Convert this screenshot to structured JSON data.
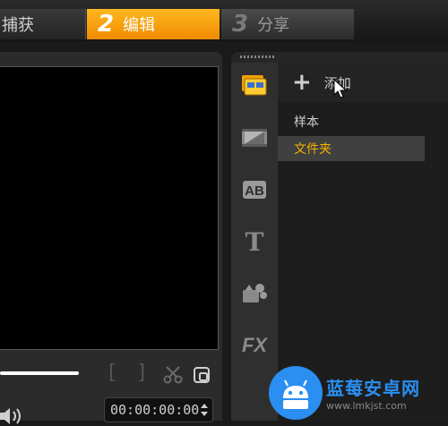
{
  "steps": [
    {
      "num": "",
      "label": "捕获"
    },
    {
      "num": "2",
      "label": "编辑"
    },
    {
      "num": "3",
      "label": "分享"
    }
  ],
  "preview": {
    "bracket_in": "[",
    "bracket_out": "]",
    "timecode": "00:00:00:00"
  },
  "library": {
    "add_label": "添加",
    "folders": [
      "样本",
      "文件夹"
    ],
    "side_icons": [
      "media-icon",
      "transition-icon",
      "title-overlay-icon",
      "title-icon",
      "graphics-icon",
      "fx-icon"
    ],
    "side_text": {
      "t": "T",
      "fx": "FX"
    }
  },
  "watermark": {
    "brand": "蓝莓安卓网",
    "url": "www.lmkjst.com"
  },
  "colors": {
    "accent": "#f5a000",
    "selected_folder_text": "#f4b400",
    "watermark_blue": "#2a8ff0"
  }
}
